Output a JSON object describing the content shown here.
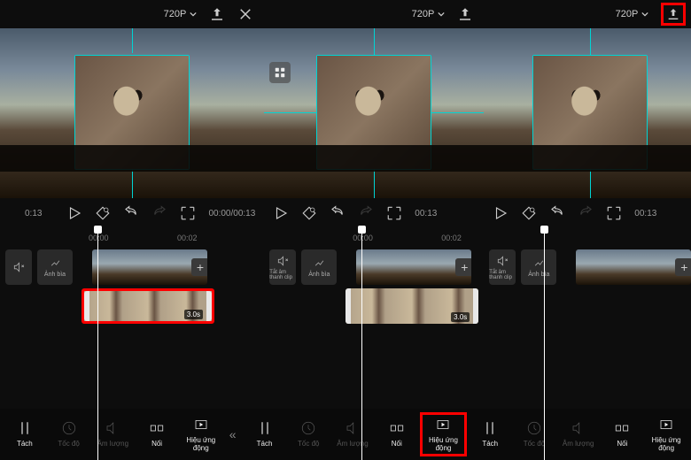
{
  "resolution": "720P",
  "timecode_full": "00:00/00:13",
  "timecode_short": "00:13",
  "timecode_left": "0:13",
  "ruler": {
    "t1": "00:00",
    "t2": "00:02",
    "t3": "00:00",
    "t4": "00:02"
  },
  "clip_duration": "3.0s",
  "mute_label": "Tắt âm thanh clip",
  "cover_label": "Ảnh bìa",
  "tools": {
    "split": "Tách",
    "speed": "Tốc độ",
    "volume": "Âm lượng",
    "join": "Nối",
    "animation": "Hiệu ứng động"
  },
  "clip_widths": {
    "p1_sky": 130,
    "p1_cat": 150,
    "p2_sky": 130,
    "p2_cat": 150,
    "p3_sky": 130
  },
  "playhead_x": {
    "p1": 110,
    "p2": 110,
    "p3": 68
  }
}
